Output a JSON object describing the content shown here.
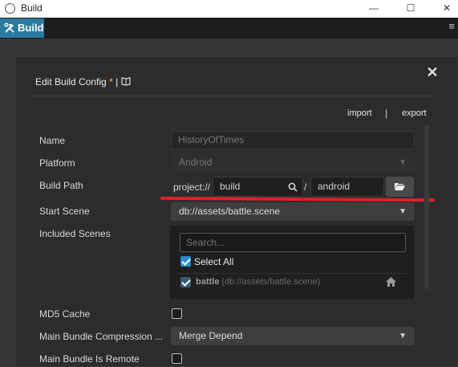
{
  "window": {
    "title": "Build",
    "minimize_glyph": "—",
    "maximize_glyph": "☐",
    "close_glyph": "✕"
  },
  "tab": {
    "label": "Build",
    "icon": "hammer-wrench-icon"
  },
  "menu_glyph": "≡",
  "dialog": {
    "title": "Edit Build Config",
    "modified_marker": "*",
    "separator": "|",
    "close_glyph": "✕",
    "import_label": "import",
    "link_separator": "|",
    "export_label": "export"
  },
  "form": {
    "name": {
      "label": "Name",
      "value": "HistoryOfTimes"
    },
    "platform": {
      "label": "Platform",
      "value": "Android"
    },
    "build_path": {
      "label": "Build Path",
      "prefix": "project://",
      "value": "build",
      "separator": "/",
      "subdir": "android"
    },
    "start_scene": {
      "label": "Start Scene",
      "value": "db://assets/battle.scene"
    },
    "included_scenes": {
      "label": "Included Scenes",
      "search_placeholder": "Search...",
      "select_all_label": "Select All",
      "select_all_checked": true,
      "items": [
        {
          "name": "battle",
          "path": "(db://assets/battle.scene)",
          "checked": true
        }
      ]
    },
    "md5_cache": {
      "label": "MD5 Cache",
      "checked": false
    },
    "main_bundle_compression": {
      "label": "Main Bundle Compression ...",
      "value": "Merge Depend"
    },
    "main_bundle_is_remote": {
      "label": "Main Bundle Is Remote",
      "checked": false
    }
  },
  "colors": {
    "accent": "#2b7aa0",
    "checkbox_checked": "#2d8ed0",
    "highlight_line": "#e0202a",
    "modified_star": "#ffc530"
  }
}
